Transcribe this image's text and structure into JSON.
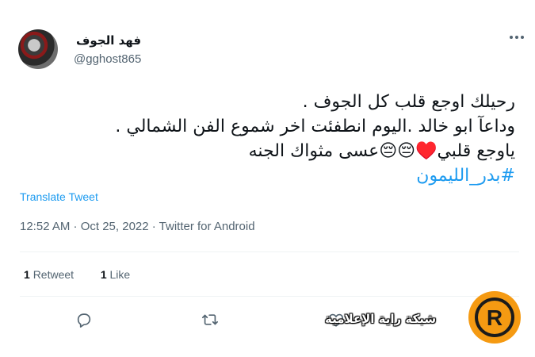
{
  "author": {
    "name": "فهد الجوف",
    "handle": "@gghost865"
  },
  "tweet": {
    "lines": [
      "رحيلك اوجع قلب كل الجوف .",
      "وداعآ ابو خالد .اليوم انطفئت اخر شموع الفن الشمالي .",
      "ياوجع قلبي♥️😔😔عسى مثواك الجنه"
    ],
    "hashtag": "#بدر_الليمون"
  },
  "translate_label": "Translate Tweet",
  "meta": "12:52 AM · Oct 25, 2022 · Twitter for Android",
  "stats": {
    "retweets_count": "1",
    "retweets_label": "Retweet",
    "likes_count": "1",
    "likes_label": "Like"
  },
  "watermark": {
    "text": "شبكة راية الإعلامية",
    "logo_letter": "R"
  },
  "icons": {
    "reply": "reply-icon",
    "retweet": "retweet-icon",
    "like": "heart-icon",
    "more": "more-icon"
  },
  "colors": {
    "link": "#1d9bf0",
    "secondary_text": "#536471",
    "logo_orange": "#f59a12"
  }
}
